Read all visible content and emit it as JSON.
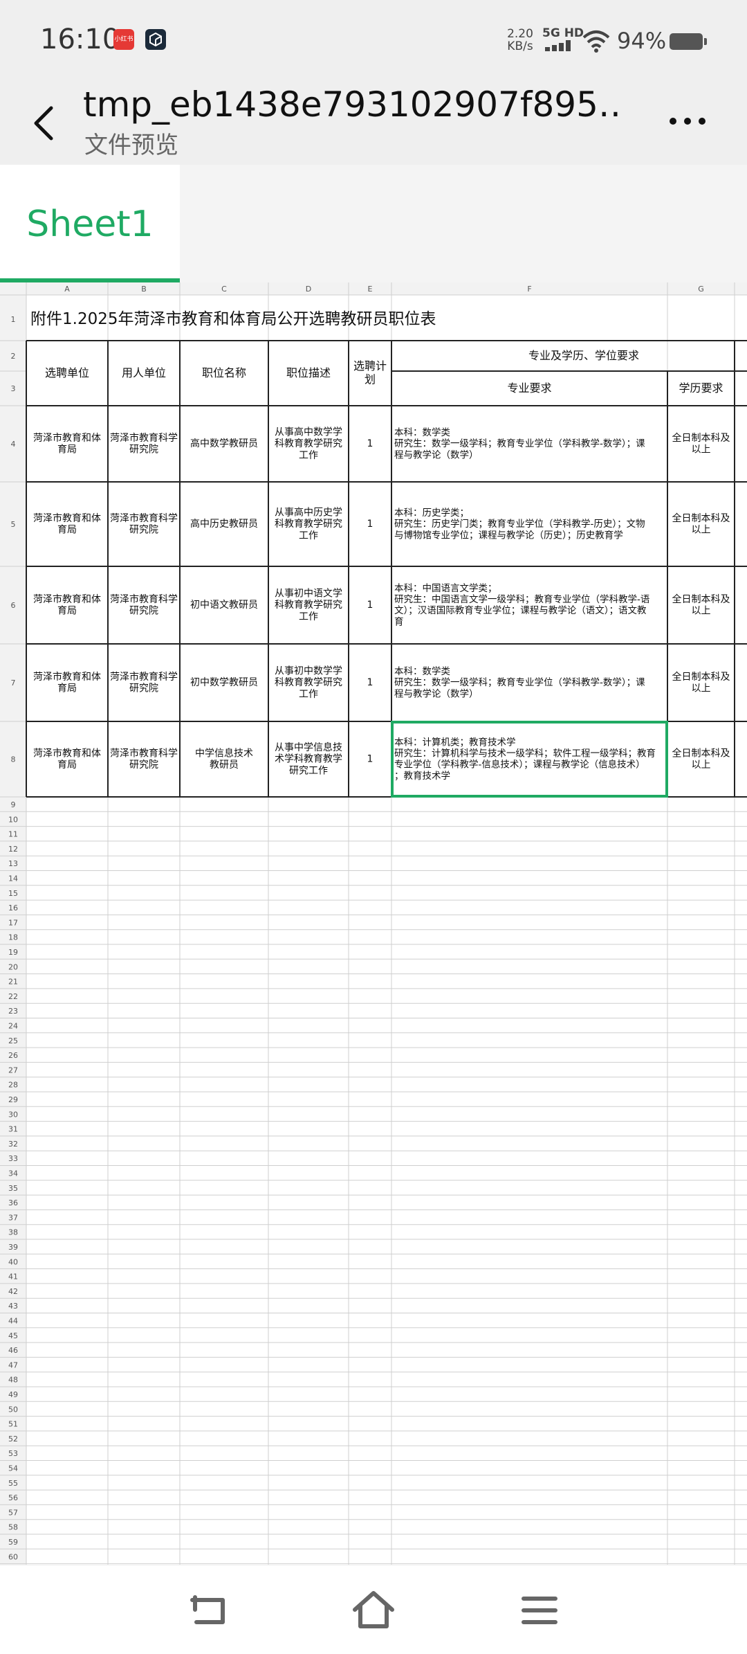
{
  "status_bar": {
    "time": "16:10",
    "app_badge_red_text": "小红书",
    "net_speed_value": "2.20",
    "net_speed_unit": "KB/s",
    "network_type": "5G HD",
    "battery_percent": "94%",
    "icons": [
      "app-red-icon",
      "app-cube-icon",
      "signal-icon",
      "wifi-icon",
      "battery-icon"
    ]
  },
  "title_bar": {
    "title": "tmp_eb1438e793102907f895…",
    "subtitle": "文件预览",
    "icons": [
      "back-arrow-icon",
      "more-dots-icon"
    ]
  },
  "sheet_tabs": [
    {
      "label": "Sheet1",
      "active": true
    }
  ],
  "colors": {
    "accent": "#1faa63",
    "grid": "#cfcfcf",
    "header_bg": "#f2f2f2",
    "border": "#222222"
  },
  "spreadsheet": {
    "column_letters": [
      "A",
      "B",
      "C",
      "D",
      "E",
      "F",
      "G"
    ],
    "title": "附件1.2025年菏泽市教育和体育局公开选聘教研员职位表",
    "headers": {
      "unit": "选聘单位",
      "employer": "用人单位",
      "position": "职位名称",
      "description": "职位描述",
      "plan": "选聘计划",
      "requirements_group": "专业及学历、学位要求",
      "major": "专业要求",
      "education": "学历要求"
    },
    "rows": [
      {
        "num": "4",
        "unit": "菏泽市教育和体育局",
        "employer": "菏泽市教育科学研究院",
        "position": "高中数学教研员",
        "description": "从事高中数学学科教育教学研究工作",
        "plan": "1",
        "major": [
          "本科：数学类",
          "研究生：数学一级学科；教育专业学位（学科教学-数学）；课程与教学论（数学）"
        ],
        "education": "全日制本科及以上"
      },
      {
        "num": "5",
        "unit": "菏泽市教育和体育局",
        "employer": "菏泽市教育科学研究院",
        "position": "高中历史教研员",
        "description": "从事高中历史学科教育教学研究工作",
        "plan": "1",
        "major": [
          "本科：历史学类；",
          "研究生：历史学门类；教育专业学位（学科教学-历史）；文物与博物馆专业学位；课程与教学论（历史）；历史教育学"
        ],
        "education": "全日制本科及以上"
      },
      {
        "num": "6",
        "unit": "菏泽市教育和体育局",
        "employer": "菏泽市教育科学研究院",
        "position": "初中语文教研员",
        "description": "从事初中语文学科教育教学研究工作",
        "plan": "1",
        "major": [
          "本科：中国语言文学类；",
          "研究生：中国语言文学一级学科；教育专业学位（学科教学-语文）；汉语国际教育专业学位；课程与教学论（语文）；语文教育"
        ],
        "education": "全日制本科及以上"
      },
      {
        "num": "7",
        "unit": "菏泽市教育和体育局",
        "employer": "菏泽市教育科学研究院",
        "position": "初中数学教研员",
        "description": "从事初中数学学科教育教学研究工作",
        "plan": "1",
        "major": [
          "本科：数学类",
          "研究生：数学一级学科；教育专业学位（学科教学-数学）；课程与教学论（数学）"
        ],
        "education": "全日制本科及以上"
      },
      {
        "num": "8",
        "unit": "菏泽市教育和体育局",
        "employer": "菏泽市教育科学研究院",
        "position": "中学信息技术教研员",
        "description": "从事中学信息技术学科教育教学研究工作",
        "plan": "1",
        "major": [
          "本科：计算机类；教育技术学",
          "研究生：计算机科学与技术一级学科；软件工程一级学科；教育专业学位（学科教学-信息技术）；课程与教学论（信息技术）；教育技术学"
        ],
        "education": "全日制本科及以上"
      }
    ],
    "selected_cell": "F8",
    "visible_row_count": 60
  },
  "nav_bar": {
    "icons": [
      "back-nav-icon",
      "home-nav-icon",
      "menu-nav-icon"
    ]
  }
}
